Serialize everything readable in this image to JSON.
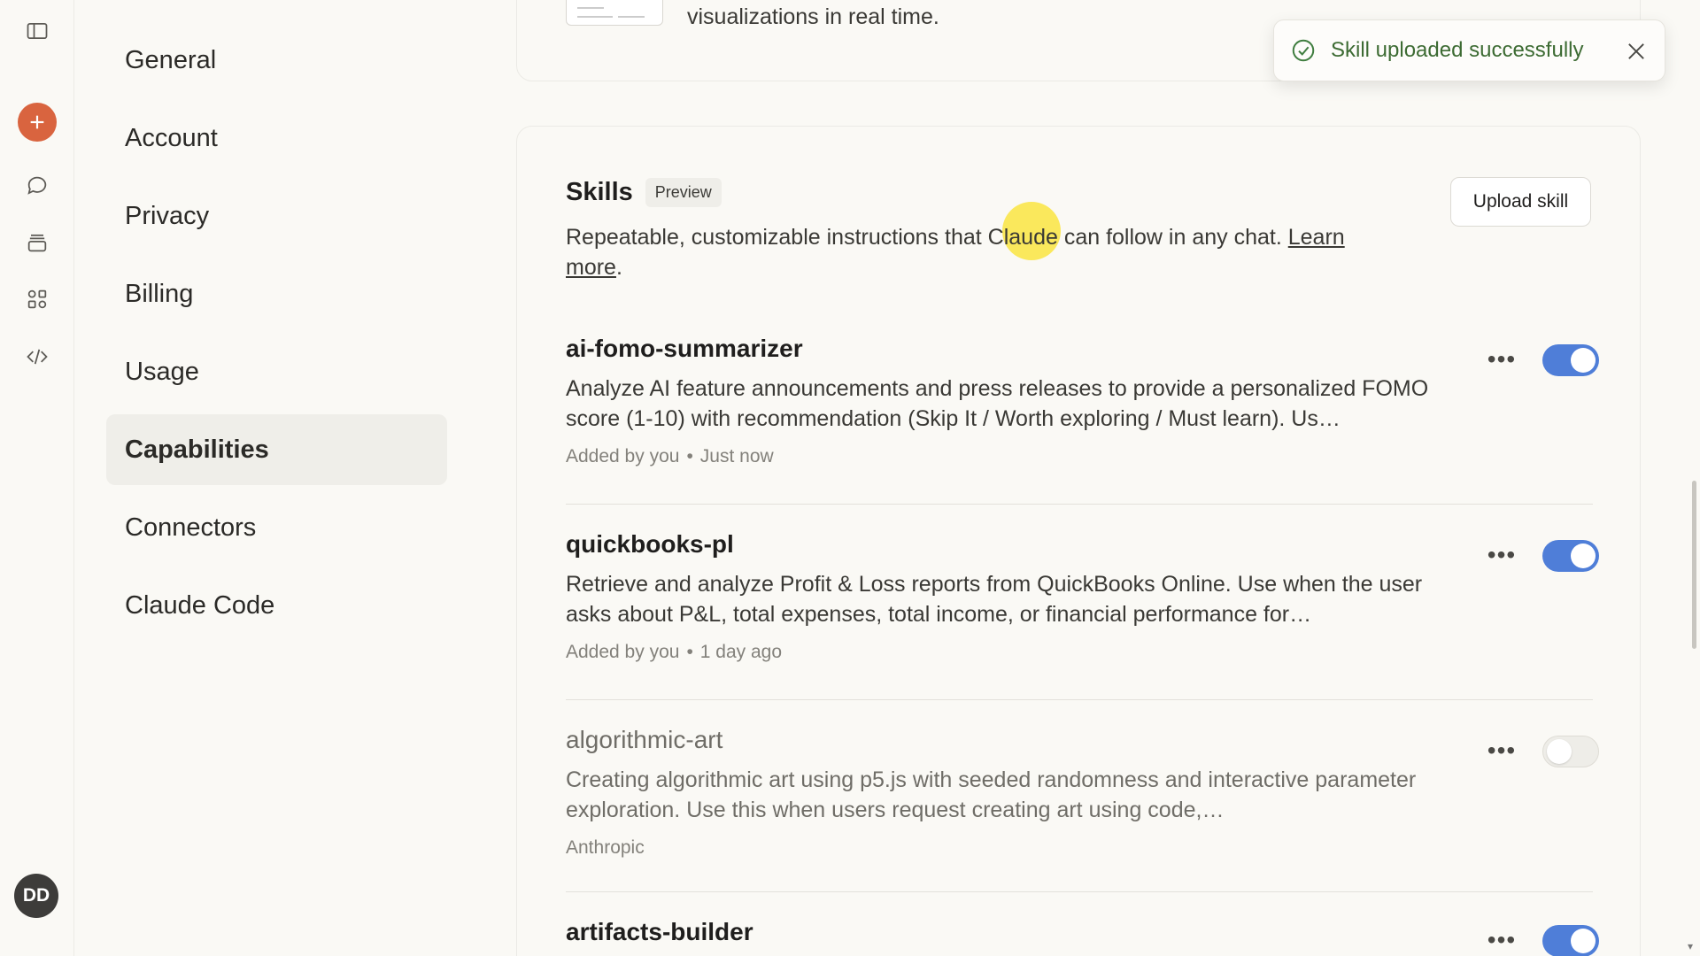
{
  "rail": {
    "avatar_initials": "DD",
    "icons": [
      "sidebar-toggle-icon",
      "new-chat-icon",
      "chats-icon",
      "projects-icon",
      "artifacts-icon",
      "code-icon"
    ],
    "accent_color": "#d9643f"
  },
  "nav": {
    "items": [
      {
        "label": "General"
      },
      {
        "label": "Account"
      },
      {
        "label": "Privacy"
      },
      {
        "label": "Billing"
      },
      {
        "label": "Usage"
      },
      {
        "label": "Capabilities"
      },
      {
        "label": "Connectors"
      },
      {
        "label": "Claude Code"
      }
    ],
    "active": "Capabilities"
  },
  "top_card": {
    "description": "visualizations in real time."
  },
  "skills": {
    "title": "Skills",
    "badge": "Preview",
    "upload_label": "Upload skill",
    "description": "Repeatable, customizable instructions that Claude can follow in any chat.",
    "learn_more": "Learn more",
    "items": [
      {
        "name": "ai-fomo-summarizer",
        "description": "Analyze AI feature announcements and press releases to provide a personalized FOMO score (1-10) with recommendation (Skip It / Worth exploring / Must learn). Us…",
        "added_by": "Added by you",
        "time": "Just now",
        "enabled": true
      },
      {
        "name": "quickbooks-pl",
        "description": "Retrieve and analyze Profit & Loss reports from QuickBooks Online. Use when the user asks about P&L, total expenses, total income, or financial performance for…",
        "added_by": "Added by you",
        "time": "1 day ago",
        "enabled": true
      },
      {
        "name": "algorithmic-art",
        "description": "Creating algorithmic art using p5.js with seeded randomness and interactive parameter exploration. Use this when users request creating art using code,…",
        "added_by": "Anthropic",
        "time": "",
        "enabled": false
      },
      {
        "name": "artifacts-builder",
        "description": "",
        "added_by": "",
        "time": "",
        "enabled": true
      }
    ],
    "more_label": "•••"
  },
  "toast": {
    "message": "Skill uploaded successfully",
    "color": "#3d6b33"
  },
  "colors": {
    "toggle_on": "#4f7ed8",
    "background": "#faf9f5"
  }
}
